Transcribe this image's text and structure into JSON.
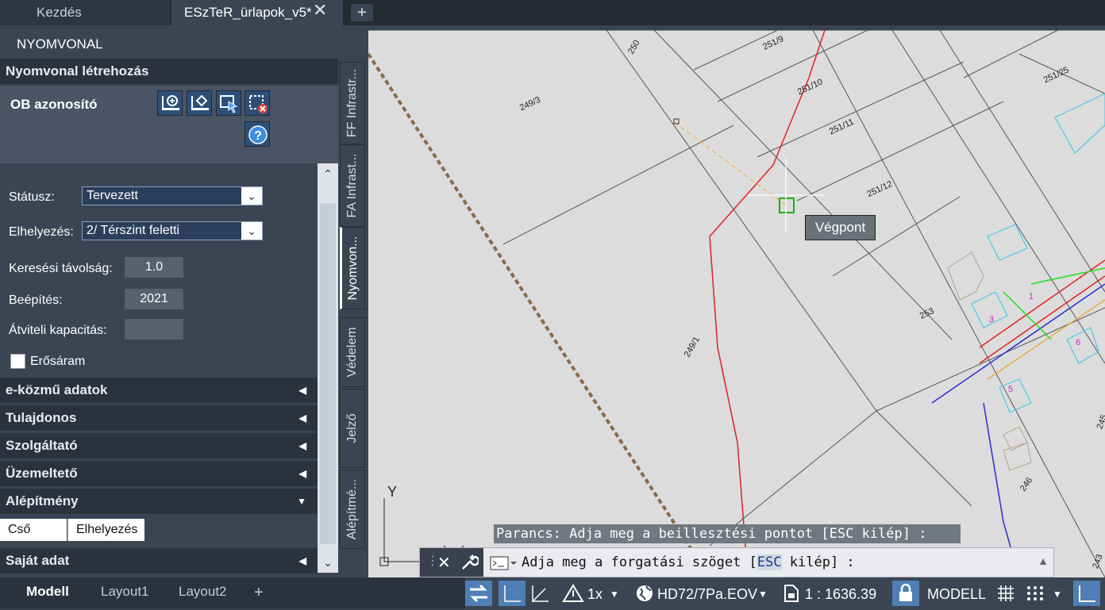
{
  "tabs": {
    "home": "Kezdés",
    "file": "ESzTeR_ürlapok_v5*",
    "close": "✕",
    "add": "+"
  },
  "panel": {
    "title": "NYOMVONAL",
    "section_create": "Nyomvonal létrehozás",
    "ob_label": "OB azonosító",
    "status_label": "Státusz:",
    "status_value": "Tervezett",
    "placement_label": "Elhelyezés:",
    "placement_value": "2/ Térszint feletti",
    "search_label": "Keresési távolság:",
    "search_value": "1.0",
    "build_label": "Beépítés:",
    "build_value": "2021",
    "capacity_label": "Átviteli kapacitás:",
    "capacity_value": "",
    "power_label": "Erősáram",
    "sections": [
      "e-közmű adatok",
      "Tulajdonos",
      "Szolgáltató",
      "Üzemeltető",
      "Alépítmény",
      "Saját adat"
    ],
    "subtabs": [
      "Cső",
      "Elhelyezés"
    ]
  },
  "vtabs": [
    "FF Infrastr...",
    "FA Infrast...",
    "Nyomvon...",
    "Védelem",
    "Jelző",
    "Alépítmé..."
  ],
  "drawing": {
    "parcels": [
      "250",
      "251/9",
      "251/10",
      "251/11",
      "251/12",
      "251/25",
      "249/3",
      "249/1",
      "253",
      "246",
      "245",
      "243",
      "1",
      "3",
      "5",
      "6"
    ],
    "tooltip": "Végpont",
    "ucs_y": "Y"
  },
  "command": {
    "prompt1": "Parancs: Adja meg a beillesztési pontot [ESC kilép] :",
    "prompt2_a": "Adja meg a forgatási szöget [",
    "prompt2_esc": "ESC",
    "prompt2_b": " kilép] :"
  },
  "status": {
    "layout_tabs": [
      "Modell",
      "Layout1",
      "Layout2"
    ],
    "add": "+",
    "scale_annot": "1x",
    "coord_system": "HD72/7Pa.EOV",
    "scale": "1 : 1636.39",
    "space": "MODELL"
  }
}
